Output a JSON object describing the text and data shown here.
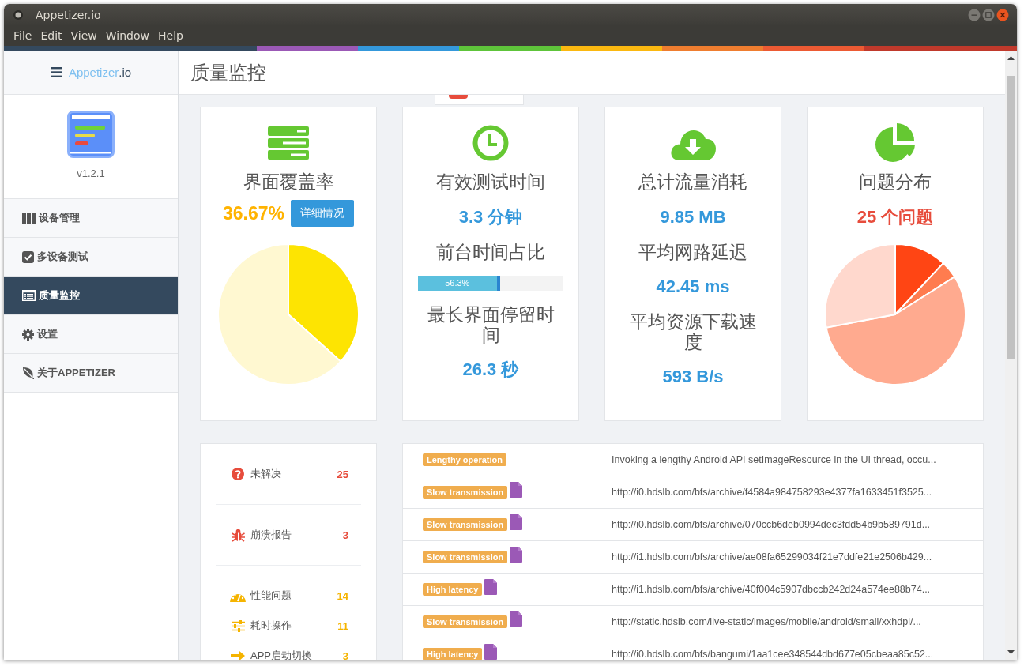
{
  "window": {
    "title": "Appetizer.io"
  },
  "menu": [
    "File",
    "Edit",
    "View",
    "Window",
    "Help"
  ],
  "sidebar": {
    "brand_name": "Appetizer",
    "brand_suffix": ".io",
    "version": "v1.2.1",
    "nav": [
      {
        "label": "设备管理",
        "selected": false
      },
      {
        "label": "多设备测试",
        "selected": false
      },
      {
        "label": "质量监控",
        "selected": true
      },
      {
        "label": "设置",
        "selected": false
      },
      {
        "label": "关于APPETIZER",
        "selected": false
      }
    ]
  },
  "header": {
    "title": "质量监控"
  },
  "cards": [
    {
      "kind": "coverage",
      "title": "界面覆盖率",
      "value": "36.67%",
      "button": "详细情况",
      "chart_data": {
        "type": "pie",
        "values": [
          36.67,
          63.33
        ]
      }
    },
    {
      "kind": "stats",
      "title": "有效测试时间",
      "rows": [
        {
          "kind": "value",
          "text": "3.3 分钟"
        },
        {
          "kind": "label",
          "text": "前台时间占比"
        },
        {
          "kind": "progress",
          "text": "56.3%",
          "level": 0.563
        },
        {
          "kind": "label",
          "text": "最长界面停留时间"
        },
        {
          "kind": "value",
          "text": "26.3 秒"
        }
      ]
    },
    {
      "kind": "stats",
      "title": "总计流量消耗",
      "rows": [
        {
          "kind": "value",
          "text": "9.85 MB"
        },
        {
          "kind": "label",
          "text": "平均网路延迟"
        },
        {
          "kind": "value",
          "text": "42.45 ms"
        },
        {
          "kind": "label",
          "text": "平均资源下载速度"
        },
        {
          "kind": "value",
          "text": "593 B/s"
        }
      ]
    },
    {
      "kind": "issues",
      "title": "问题分布",
      "value": "25 个问题"
    }
  ],
  "issue_summary": {
    "groups": [
      {
        "items": [
          {
            "label": "未解决",
            "count": "25",
            "color": "#e74c3c"
          }
        ]
      },
      {
        "items": [
          {
            "label": "崩溃报告",
            "count": "3",
            "color": "#e74c3c"
          }
        ]
      },
      {
        "items": [
          {
            "label": "性能问题",
            "count": "14",
            "color": "#f5b400"
          },
          {
            "label": "耗时操作",
            "count": "11",
            "color": "#f5b400"
          },
          {
            "label": "APP启动切换",
            "count": "3",
            "color": "#f5b400"
          }
        ]
      }
    ]
  },
  "issues_table": {
    "rows": [
      {
        "tag": "Lengthy operation",
        "attachment": false,
        "description": "Invoking a lengthy Android API setImageResource in the UI thread, occu..."
      },
      {
        "tag": "Slow transmission",
        "attachment": true,
        "description": "http://i0.hdslb.com/bfs/archive/f4584a984758293e4377fa1633451f3525..."
      },
      {
        "tag": "Slow transmission",
        "attachment": true,
        "description": "http://i0.hdslb.com/bfs/archive/070ccb6deb0994dec3fdd54b9b589791d..."
      },
      {
        "tag": "Slow transmission",
        "attachment": true,
        "description": "http://i1.hdslb.com/bfs/archive/ae08fa65299034f21e7ddfe21e2506b429..."
      },
      {
        "tag": "High latency",
        "attachment": true,
        "description": "http://i1.hdslb.com/bfs/archive/40f004c5907dbccb242d24a574ee88b74..."
      },
      {
        "tag": "Slow transmission",
        "attachment": true,
        "description": "http://static.hdslb.com/live-static/images/mobile/android/small/xxhdpi/..."
      },
      {
        "tag": "High latency",
        "attachment": true,
        "description": "http://i0.hdslb.com/bfs/bangumi/1aa1cee348544dbd677e05cbeaa85c52..."
      }
    ]
  }
}
